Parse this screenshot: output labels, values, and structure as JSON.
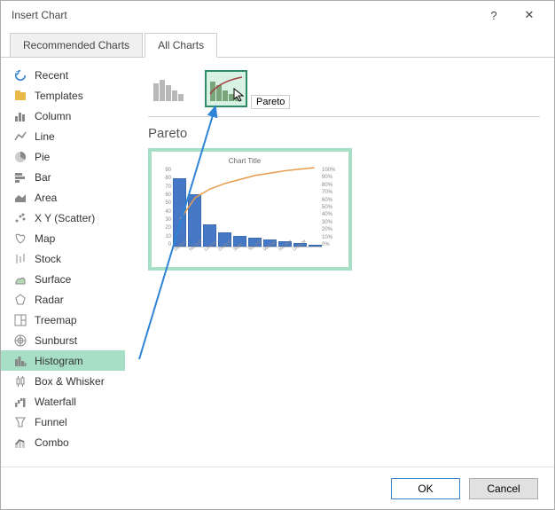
{
  "dialog": {
    "title": "Insert Chart",
    "help_label": "?",
    "close_label": "✕"
  },
  "tabs": [
    {
      "label": "Recommended Charts",
      "active": false
    },
    {
      "label": "All Charts",
      "active": true
    }
  ],
  "sidebar": {
    "items": [
      {
        "label": "Recent",
        "icon": "recent"
      },
      {
        "label": "Templates",
        "icon": "templates"
      },
      {
        "label": "Column",
        "icon": "column"
      },
      {
        "label": "Line",
        "icon": "line"
      },
      {
        "label": "Pie",
        "icon": "pie"
      },
      {
        "label": "Bar",
        "icon": "bar"
      },
      {
        "label": "Area",
        "icon": "area"
      },
      {
        "label": "X Y (Scatter)",
        "icon": "scatter"
      },
      {
        "label": "Map",
        "icon": "map"
      },
      {
        "label": "Stock",
        "icon": "stock"
      },
      {
        "label": "Surface",
        "icon": "surface"
      },
      {
        "label": "Radar",
        "icon": "radar"
      },
      {
        "label": "Treemap",
        "icon": "treemap"
      },
      {
        "label": "Sunburst",
        "icon": "sunburst"
      },
      {
        "label": "Histogram",
        "icon": "histogram",
        "selected": true
      },
      {
        "label": "Box & Whisker",
        "icon": "box"
      },
      {
        "label": "Waterfall",
        "icon": "waterfall"
      },
      {
        "label": "Funnel",
        "icon": "funnel"
      },
      {
        "label": "Combo",
        "icon": "combo"
      }
    ]
  },
  "subtypes": {
    "tooltip": "Pareto",
    "items": [
      {
        "name": "histogram-subtype",
        "selected": false
      },
      {
        "name": "pareto-subtype",
        "selected": true
      }
    ]
  },
  "preview": {
    "heading": "Pareto",
    "title": "Chart Title"
  },
  "buttons": {
    "ok": "OK",
    "cancel": "Cancel"
  },
  "chart_data": {
    "type": "bar",
    "title": "Chart Title",
    "categories": [
      "Doesn't taste...",
      "Not salt...",
      "Low quality",
      "Overpriced",
      "Stale",
      "Too small",
      "Wrong prod...",
      "Not fit enou...",
      "Unexpected...",
      ""
    ],
    "values": [
      78,
      60,
      25,
      16,
      12,
      10,
      8,
      6,
      4,
      2
    ],
    "ylim": [
      0,
      90
    ],
    "yticks": [
      90,
      80,
      70,
      60,
      50,
      40,
      30,
      20,
      10,
      0
    ],
    "secondary_yticks": [
      "100%",
      "90%",
      "80%",
      "70%",
      "60%",
      "50%",
      "40%",
      "30%",
      "20%",
      "10%",
      "0%"
    ],
    "cumulative_line": [
      35,
      62,
      73,
      80,
      85,
      90,
      93,
      96,
      98,
      100
    ]
  }
}
